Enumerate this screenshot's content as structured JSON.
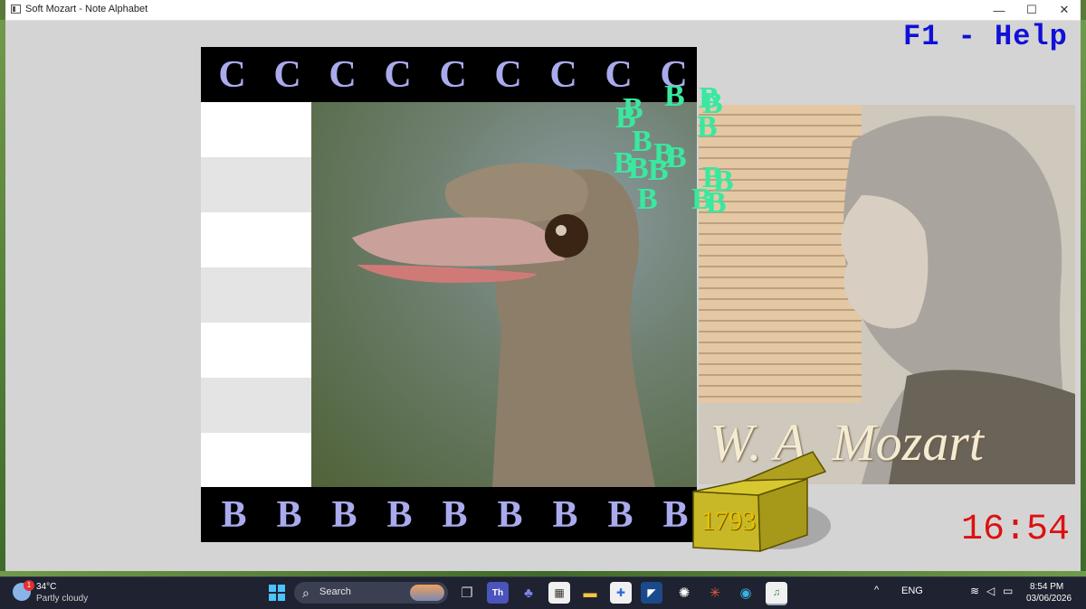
{
  "window": {
    "title": "Soft Mozart - Note Alphabet"
  },
  "controls": {
    "minimize": "—",
    "maximize": "☐",
    "close": "✕"
  },
  "help_text": "F1 - Help",
  "top_notes": [
    "C",
    "C",
    "C",
    "C",
    "C",
    "C",
    "C",
    "C",
    "C"
  ],
  "bottom_notes": [
    "B",
    "B",
    "B",
    "B",
    "B",
    "B",
    "B",
    "B",
    "B"
  ],
  "burst_letter": "B",
  "chest_count": "1793",
  "clock": "16:54",
  "mozart_signature": "W. A. Mozart",
  "colors": {
    "note": "#aaaaee",
    "burst": "#3ae8a0",
    "help": "#1010d8",
    "clock": "#dd1010",
    "chest_count": "#e8c000"
  },
  "taskbar": {
    "weather": {
      "temp": "34°C",
      "desc": "Partly cloudy",
      "badge": "1"
    },
    "search_label": "Search",
    "language": "ENG",
    "time": "8:54 PM",
    "date": "03/06/2026",
    "pinned_icons": [
      "windows-start-icon",
      "search-icon",
      "task-view-icon",
      "teams-icon",
      "teams-people-icon",
      "store-icon",
      "file-explorer-icon",
      "app-icon",
      "media-icon",
      "chatgpt-icon",
      "spark-icon",
      "edge-icon",
      "soft-mozart-icon"
    ]
  }
}
